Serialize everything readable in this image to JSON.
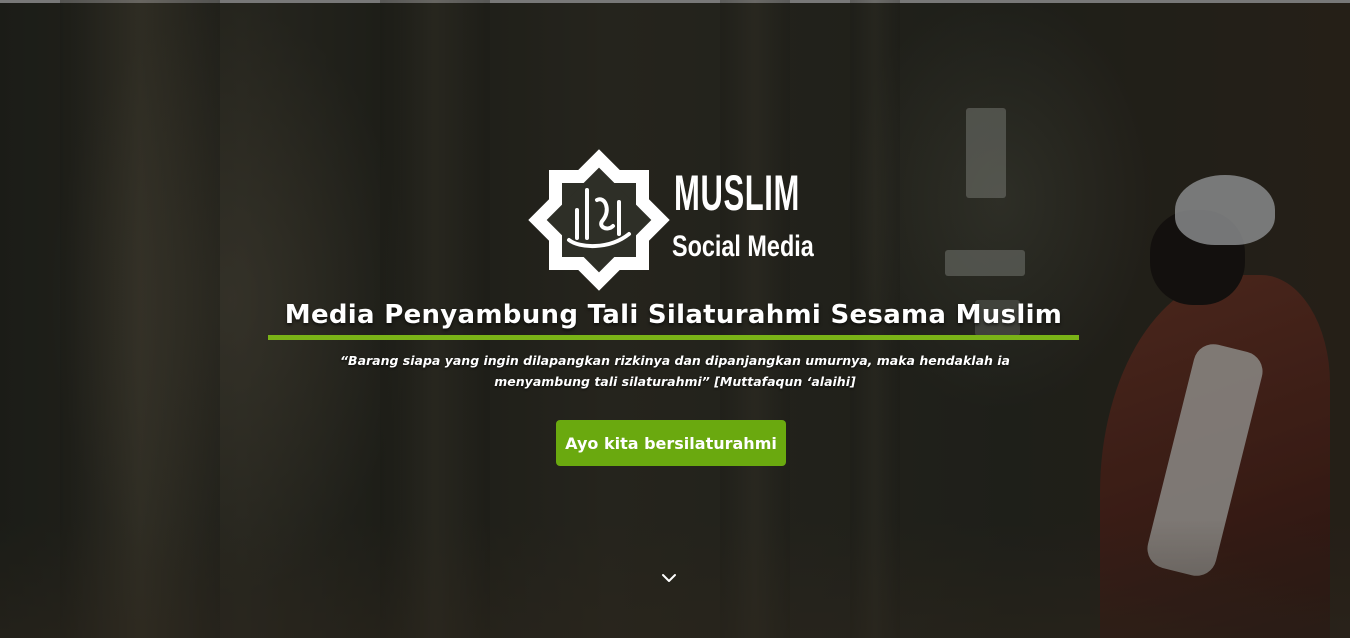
{
  "brand": {
    "logo_word_top": "MUSLIM",
    "logo_word_bottom": "Social Media",
    "logo_emblem_text": "Islam",
    "accent_color": "#7ab317",
    "button_color": "#6aa90f"
  },
  "hero": {
    "headline": "Media Penyambung Tali Silaturahmi Sesama Muslim",
    "quote": "“Barang siapa yang ingin dilapangkan rizkinya dan dipanjangkan umurnya, maka hendaklah ia menyambung tali silaturahmi” [Muttafaqun ‘alaihi]",
    "cta_label": "Ayo kita bersilaturahmi",
    "scroll_icon": "chevron-down-icon"
  }
}
